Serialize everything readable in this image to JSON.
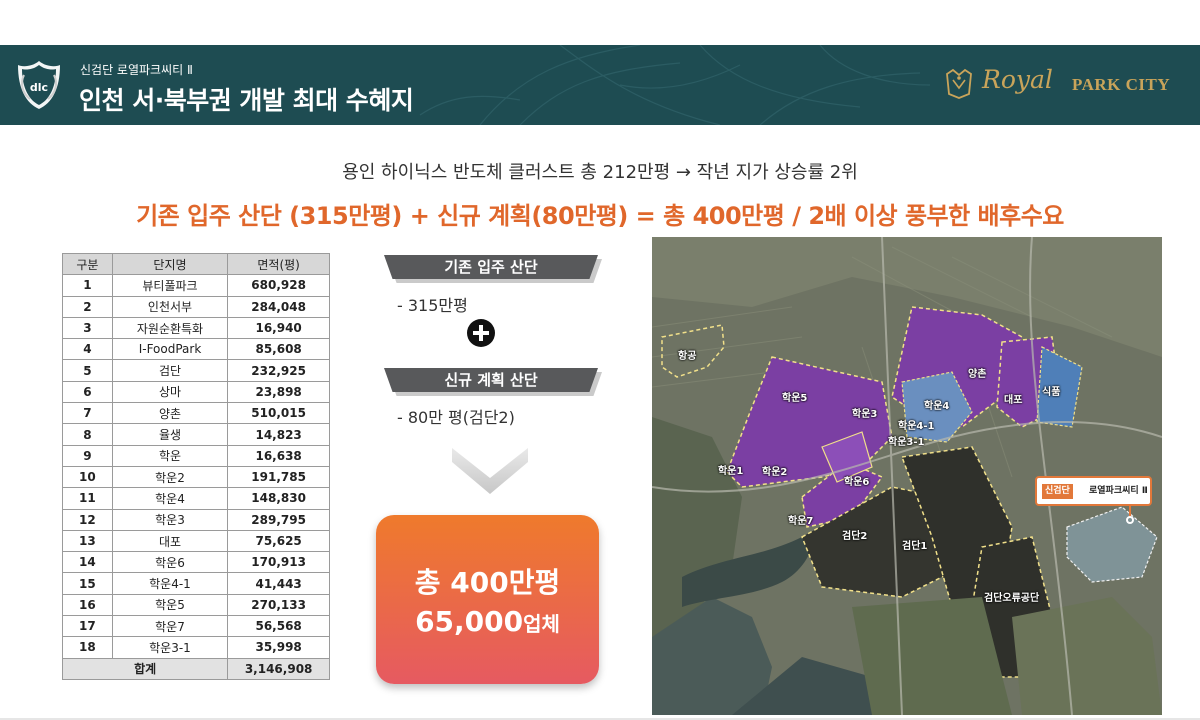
{
  "header": {
    "subtitle": "신검단 로열파크씨티 Ⅱ",
    "title": "인천 서·북부권 개발 최대 수혜지",
    "emblem_text": "dlc",
    "logo_royal": "Royal",
    "logo_park": "PARK CITY"
  },
  "headline": {
    "line1": "용인 하이닉스 반도체 클러스트 총 212만평 → 작년 지가 상승률 2위",
    "line2": "기존 입주 산단 (315만평) + 신규 계획(80만평) = 총 400만평 / 2배 이상 풍부한 배후수요"
  },
  "table": {
    "headers": [
      "구분",
      "단지명",
      "면적(평)"
    ],
    "rows": [
      [
        "1",
        "뷰티풀파크",
        "680,928"
      ],
      [
        "2",
        "인천서부",
        "284,048"
      ],
      [
        "3",
        "자원순환특화",
        "16,940"
      ],
      [
        "4",
        "I-FoodPark",
        "85,608"
      ],
      [
        "5",
        "검단",
        "232,925"
      ],
      [
        "6",
        "상마",
        "23,898"
      ],
      [
        "7",
        "양촌",
        "510,015"
      ],
      [
        "8",
        "율생",
        "14,823"
      ],
      [
        "9",
        "학운",
        "16,638"
      ],
      [
        "10",
        "학운2",
        "191,785"
      ],
      [
        "11",
        "학운4",
        "148,830"
      ],
      [
        "12",
        "학운3",
        "289,795"
      ],
      [
        "13",
        "대포",
        "75,625"
      ],
      [
        "14",
        "학운6",
        "170,913"
      ],
      [
        "15",
        "학운4-1",
        "41,443"
      ],
      [
        "16",
        "학운5",
        "270,133"
      ],
      [
        "17",
        "학운7",
        "56,568"
      ],
      [
        "18",
        "학운3-1",
        "35,998"
      ]
    ],
    "total_label": "합계",
    "total_value": "3,146,908"
  },
  "panel": {
    "existing_label": "기존 입주 산단",
    "existing_value": "- 315만평",
    "new_label": "신규 계획 산단",
    "new_value": "- 80만 평(검단2)",
    "total_line1": "총 400만평",
    "total_line2_num": "65,000",
    "total_line2_unit": "업체"
  },
  "map": {
    "labels": {
      "airport": "항공",
      "hakun5": "학운5",
      "hakun3": "학운3",
      "hakun1": "학운1",
      "hakun2": "학운2",
      "hakun6": "학운6",
      "hakun7": "학운7",
      "yangchon": "양촌",
      "hakun4": "학운4",
      "hakun4_1": "학운4-1",
      "hakun3_1": "학운3-1",
      "daepo": "대포",
      "sikpum": "식품",
      "geomdan2": "검단2",
      "geomdan1": "검단1",
      "geomdan_oryu": "검단오류공단"
    },
    "tag_brand": "신검단",
    "tag_name": "로열파크씨티 Ⅱ"
  },
  "colors": {
    "header_bg": "#1e4c52",
    "accent_orange": "#e0672b",
    "gold": "#c9a45a",
    "ribbon": "#58595b",
    "zone_purple": "#7b3fa3",
    "zone_outline": "#f1e08a"
  }
}
